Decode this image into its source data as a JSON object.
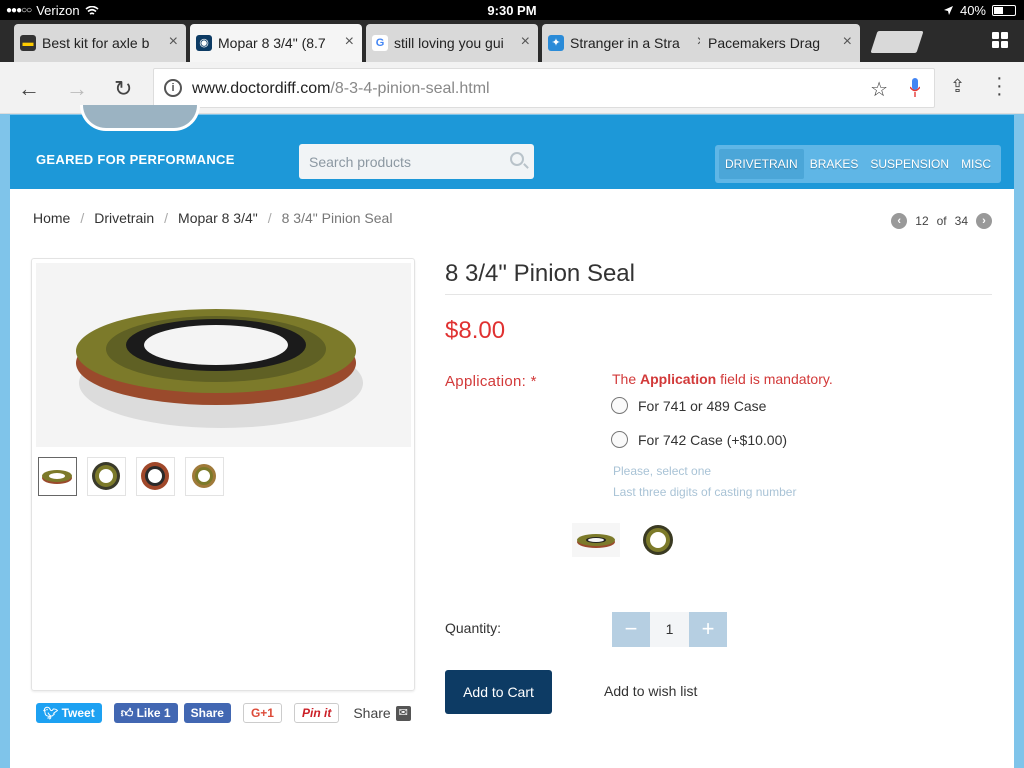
{
  "status": {
    "carrier": "Verizon",
    "time": "9:30 PM",
    "battery": "40%"
  },
  "tabs": [
    {
      "title": "Best kit for axle b",
      "close": "×"
    },
    {
      "title": "Mopar 8 3/4\" (8.7",
      "close": "×"
    },
    {
      "title": "still loving you gui",
      "close": "×"
    },
    {
      "title": "Stranger in a Stra",
      "close": "×"
    },
    {
      "title": "Pacemakers Drag",
      "close": "×"
    }
  ],
  "address": {
    "host": "www.doctordiff.com",
    "path": "/8-3-4-pinion-seal.html"
  },
  "site": {
    "tagline": "GEARED FOR PERFORMANCE",
    "search_placeholder": "Search products",
    "nav": [
      "DRIVETRAIN",
      "BRAKES",
      "SUSPENSION",
      "MISC"
    ]
  },
  "breadcrumb": [
    "Home",
    "Drivetrain",
    "Mopar 8 3/4\"",
    "8 3/4\" Pinion Seal"
  ],
  "breadcrumb_sep": "/",
  "pager": {
    "current": "12",
    "of": "of",
    "total": "34"
  },
  "product": {
    "title": "8 3/4\" Pinion Seal",
    "price": "$8.00",
    "application_label": "Application:",
    "required_mark": "*",
    "mandatory_prefix": "The",
    "mandatory_field": "Application",
    "mandatory_suffix": "field is mandatory.",
    "options": [
      "For 741 or 489 Case",
      "For 742 Case (+$10.00)"
    ],
    "hints": [
      "Please, select one",
      "Last three digits of casting number"
    ],
    "quantity_label": "Quantity:",
    "quantity": "1",
    "minus": "−",
    "plus": "+",
    "add_to_cart": "Add to Cart",
    "wishlist": "Add to wish list"
  },
  "social": {
    "tweet": "Tweet",
    "like": "Like 1",
    "share": "Share",
    "gplus": "G+1",
    "pin": "Pin it",
    "share_label": "Share"
  },
  "colors": {
    "header_blue": "#1d98d8",
    "price_red": "#e03131",
    "cart_navy": "#0d3b64",
    "seal_olive": "#7c7a2a",
    "seal_rust": "#a0482a"
  }
}
